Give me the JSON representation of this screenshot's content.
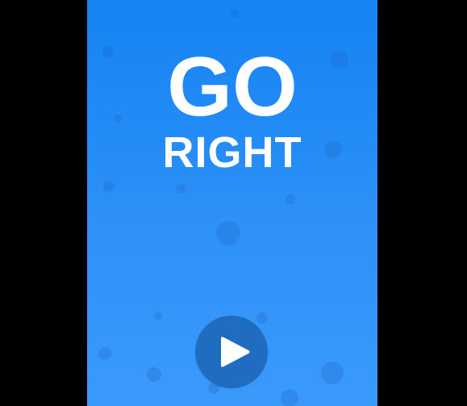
{
  "game": {
    "title_line_1": "GO",
    "title_line_2": "RIGHT"
  },
  "play_button": {
    "icon": "play-icon"
  },
  "colors": {
    "background_top": "#1583f3",
    "background_bottom": "#3a9afc",
    "title_text": "#ffffff",
    "play_button": "#1f6cc0",
    "letterbox": "#000000"
  }
}
